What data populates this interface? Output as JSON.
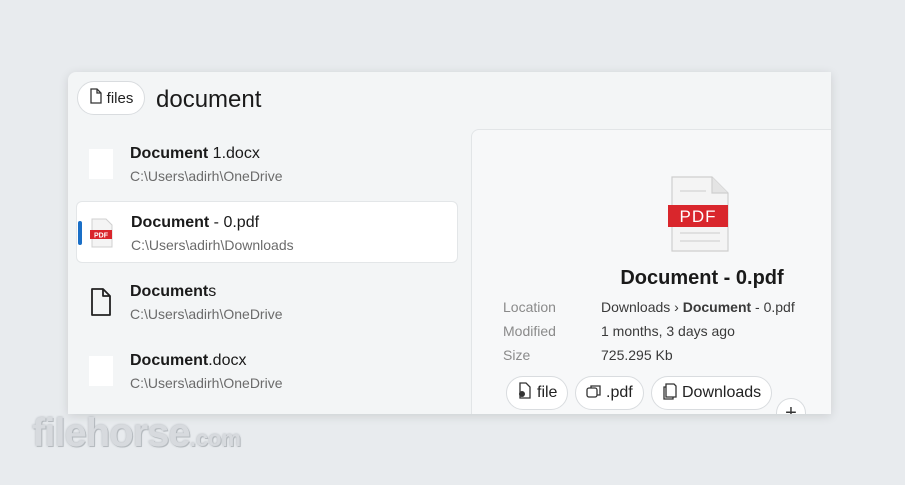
{
  "search": {
    "filter_label": "files",
    "query": "document"
  },
  "results": [
    {
      "title_match": "Document",
      "title_rest": " 1.docx",
      "path": "C:\\Users\\adirh\\OneDrive",
      "icon": "docx-blank-icon",
      "selected": false
    },
    {
      "title_match": "Document",
      "title_rest": " - 0.pdf",
      "path": "C:\\Users\\adirh\\Downloads",
      "icon": "pdf-icon",
      "selected": true
    },
    {
      "title_match": "Document",
      "title_rest": "s",
      "path": "C:\\Users\\adirh\\OneDrive",
      "icon": "folder-file-icon",
      "selected": false
    },
    {
      "title_match": "Document",
      "title_rest": ".docx",
      "path": "C:\\Users\\adirh\\OneDrive",
      "icon": "docx-blank-icon",
      "selected": false
    }
  ],
  "preview": {
    "name": "Document - 0.pdf",
    "icon_label": "PDF",
    "location_label": "Location",
    "location_prefix": "Downloads › ",
    "location_match": "Document",
    "location_rest": " - 0.pdf",
    "modified_label": "Modified",
    "modified_value": "1 months, 3 days ago",
    "size_label": "Size",
    "size_value": "725.295 Kb",
    "chips": [
      {
        "label": "file",
        "icon": "file-search-icon"
      },
      {
        "label": ".pdf",
        "icon": "copy-icon"
      },
      {
        "label": "Downloads",
        "icon": "folder-copy-icon"
      }
    ],
    "add_label": "+"
  },
  "watermark": {
    "brand": "filehorse",
    "suffix": ".com"
  },
  "colors": {
    "accent": "#1a6fc7",
    "pdf_red": "#d9262c"
  }
}
